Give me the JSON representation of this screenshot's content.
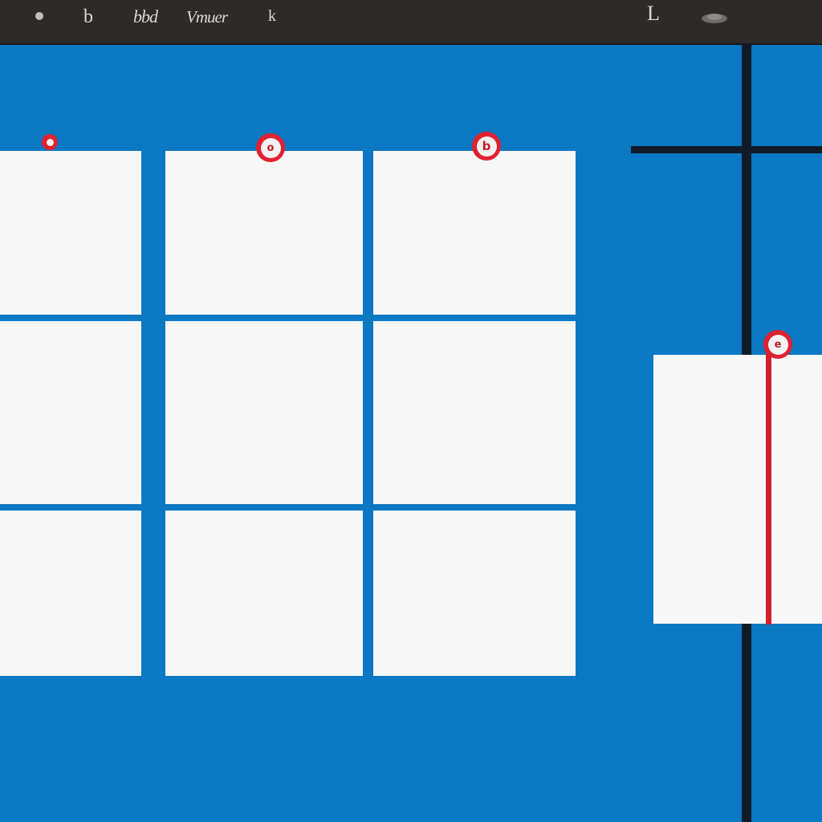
{
  "toolbar": {
    "items": [
      {
        "label": "b",
        "icon": "text-tool-icon"
      },
      {
        "label": "bbd",
        "icon": "text-tool-icon"
      },
      {
        "label": "Vmuer",
        "icon": "text-tool-icon"
      },
      {
        "label": "k",
        "icon": "cursor-icon"
      }
    ],
    "right_items": [
      {
        "label": "L",
        "icon": "bracket-icon"
      },
      {
        "label": "",
        "icon": "eye-icon"
      }
    ]
  },
  "pins": [
    {
      "glyph": ""
    },
    {
      "glyph": "o"
    },
    {
      "glyph": "b"
    },
    {
      "glyph": "e"
    }
  ],
  "colors": {
    "background": "#0a78c3",
    "toolbar": "#2e2a28",
    "card": "#f7f7f7",
    "pin": "#e0212f",
    "guide_dark": "#0f1b26",
    "guide_red": "#d4202d"
  }
}
